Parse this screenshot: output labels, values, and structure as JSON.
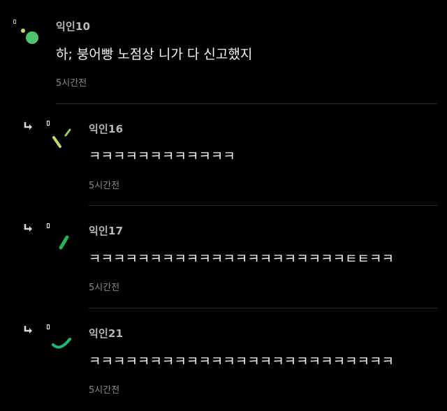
{
  "comments": [
    {
      "author": "익인10",
      "text": "하; 붕어빵 노점상 니가 다 신고했지",
      "time": "5시간전",
      "reply": false,
      "avatar_color": "#4fc46f"
    },
    {
      "author": "익인16",
      "text": "ㅋㅋㅋㅋㅋㅋㅋㅋㅋㅋㅋㅋ",
      "time": "5시간전",
      "reply": true,
      "avatar_color": "#c7d86a"
    },
    {
      "author": "익인17",
      "text": "ㅋㅋㅋㅋㅋㅋㅋㅋㅋㅋㅋㅋㅋㅋㅋㅋㅋㅋㅋㅋㅋㅌㅌㅋㅋ",
      "time": "5시간전",
      "reply": true,
      "avatar_color": "#27b35a"
    },
    {
      "author": "익인21",
      "text": "ㅋㅋㅋㅋㅋㅋㅋㅋㅋㅋㅋㅋㅋㅋㅋㅋㅋㅋㅋㅋㅋㅋㅋㅋㅋ",
      "time": "5시간전",
      "reply": true,
      "avatar_color": "#1fb877"
    }
  ]
}
